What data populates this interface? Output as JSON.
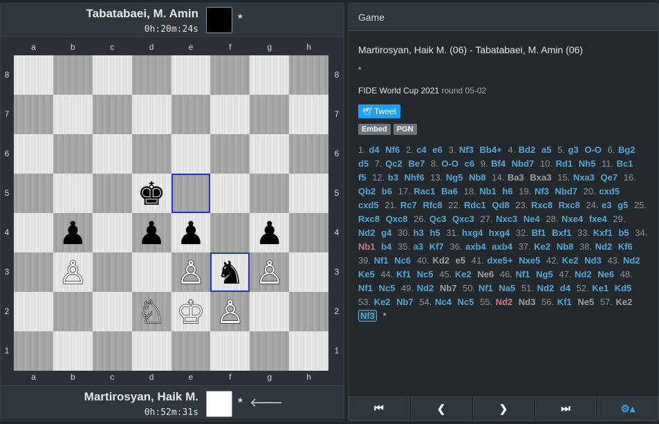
{
  "top_player": {
    "name": "Tabatabaei, M. Amin",
    "clock": "0h:20m:24s",
    "color": "#000000",
    "result": "*"
  },
  "bottom_player": {
    "name": "Martirosyan, Haik M.",
    "clock": "0h:52m:31s",
    "color": "#ffffff",
    "result": "*",
    "turn_indicator_icon": "arrow-left-icon"
  },
  "board": {
    "files": [
      "a",
      "b",
      "c",
      "d",
      "e",
      "f",
      "g",
      "h"
    ],
    "ranks": [
      "8",
      "7",
      "6",
      "5",
      "4",
      "3",
      "2",
      "1"
    ],
    "highlight": [
      "e5",
      "f3"
    ],
    "pieces": {
      "d5": {
        "glyph": "♚",
        "side": "b"
      },
      "b4": {
        "glyph": "♟",
        "side": "b"
      },
      "d4": {
        "glyph": "♟",
        "side": "b"
      },
      "e4": {
        "glyph": "♟",
        "side": "b"
      },
      "g4": {
        "glyph": "♟",
        "side": "b"
      },
      "f3": {
        "glyph": "♞",
        "side": "b"
      },
      "b3": {
        "glyph": "♙",
        "side": "w"
      },
      "e3": {
        "glyph": "♙",
        "side": "w"
      },
      "g3": {
        "glyph": "♙",
        "side": "w"
      },
      "d2": {
        "glyph": "♘",
        "side": "w"
      },
      "e2": {
        "glyph": "♔",
        "side": "w"
      },
      "f2": {
        "glyph": "♙",
        "side": "w"
      }
    }
  },
  "panel": {
    "header": "Game",
    "title": "Martirosyan, Haik M. (06) - Tabatabaei, M. Amin (06)",
    "result": "*",
    "event": "FIDE World Cup 2021",
    "round": "round 05-02",
    "tweet_label": "Tweet",
    "embed_label": "Embed",
    "pgn_label": "PGN",
    "moves": [
      [
        "1.",
        "d4",
        "Nf6"
      ],
      [
        "2.",
        "c4",
        "e6"
      ],
      [
        "3.",
        "Nf3",
        "Bb4+"
      ],
      [
        "4.",
        "Bd2",
        "a5"
      ],
      [
        "5.",
        "g3",
        "O-O"
      ],
      [
        "6.",
        "Bg2",
        "d5"
      ],
      [
        "7.",
        "Qc2",
        "Be7"
      ],
      [
        "8.",
        "O-O",
        "c6"
      ],
      [
        "9.",
        "Bf4",
        "Nbd7"
      ],
      [
        "10.",
        "Rd1",
        "Nh5"
      ],
      [
        "11.",
        "Bc1",
        "f5"
      ],
      [
        "12.",
        "b3",
        "Nhf6"
      ],
      [
        "13.",
        "Ng5",
        "Nb8"
      ],
      [
        "14.",
        "Ba3",
        "Bxa3"
      ],
      [
        "15.",
        "Nxa3",
        "Qe7"
      ],
      [
        "16.",
        "Qb2",
        "b6"
      ],
      [
        "17.",
        "Rac1",
        "Ba6"
      ],
      [
        "18.",
        "Nb1",
        "h6"
      ],
      [
        "19.",
        "Nf3",
        "Nbd7"
      ],
      [
        "20.",
        "cxd5",
        "cxd5"
      ],
      [
        "21.",
        "Rc7",
        "Rfc8"
      ],
      [
        "22.",
        "Rdc1",
        "Qd8"
      ],
      [
        "23.",
        "Rxc8",
        "Rxc8"
      ],
      [
        "24.",
        "e3",
        "g5"
      ],
      [
        "25.",
        "Rxc8",
        "Qxc8"
      ],
      [
        "26.",
        "Qc3",
        "Qxc3"
      ],
      [
        "27.",
        "Nxc3",
        "Ne4"
      ],
      [
        "28.",
        "Nxe4",
        "fxe4"
      ],
      [
        "29.",
        "Nd2",
        "g4"
      ],
      [
        "30.",
        "h3",
        "h5"
      ],
      [
        "31.",
        "hxg4",
        "hxg4"
      ],
      [
        "32.",
        "Bf1",
        "Bxf1"
      ],
      [
        "33.",
        "Kxf1",
        "b5"
      ],
      [
        "34.",
        "Nb1",
        "b4"
      ],
      [
        "35.",
        "a3",
        "Kf7"
      ],
      [
        "36.",
        "axb4",
        "axb4"
      ],
      [
        "37.",
        "Ke2",
        "Nb8"
      ],
      [
        "38.",
        "Nd2",
        "Kf6"
      ],
      [
        "39.",
        "Nf1",
        "Nc6"
      ],
      [
        "40.",
        "Kd2",
        "e5"
      ],
      [
        "41.",
        "dxe5+",
        "Nxe5"
      ],
      [
        "42.",
        "Ke2",
        "Nd3"
      ],
      [
        "43.",
        "Nd2",
        "Ke5"
      ],
      [
        "44.",
        "Kf1",
        "Nc5"
      ],
      [
        "45.",
        "Ke2",
        "Ne6"
      ],
      [
        "46.",
        "Nf1",
        "Ng5"
      ],
      [
        "47.",
        "Nd2",
        "Ne6"
      ],
      [
        "48.",
        "Nf1",
        "Nc5"
      ],
      [
        "49.",
        "Nd2",
        "Nb7"
      ],
      [
        "50.",
        "Nf1",
        "Na5"
      ],
      [
        "51.",
        "Nd2",
        "d4"
      ],
      [
        "52.",
        "Ke1",
        "Kd5"
      ],
      [
        "53.",
        "Ke2",
        "Nb7"
      ],
      [
        "54.",
        "Nc4",
        "Nc5"
      ],
      [
        "55.",
        "Nd2",
        "Nd3"
      ],
      [
        "56.",
        "Kf1",
        "Ne5"
      ],
      [
        "57.",
        "Ke2",
        "Nf3"
      ]
    ],
    "gray_moves": [
      "Ba3",
      "Bxa3",
      "Kd2",
      "e5",
      "Ne6",
      "Nc5",
      "Nd2",
      "Nd3",
      "Nf1",
      "Ng5",
      "Nc4",
      "Ke2",
      "Kf1",
      "Ne5",
      "e3",
      "g5"
    ],
    "pink_moves": [
      "Nb1",
      "Nd2"
    ],
    "final_result": "*",
    "controls": [
      {
        "name": "first-move-button",
        "glyph": "⏮"
      },
      {
        "name": "prev-move-button",
        "glyph": "❮"
      },
      {
        "name": "next-move-button",
        "glyph": "❯"
      },
      {
        "name": "last-move-button",
        "glyph": "⏭"
      },
      {
        "name": "settings-button",
        "glyph": "⚙▴"
      }
    ]
  }
}
